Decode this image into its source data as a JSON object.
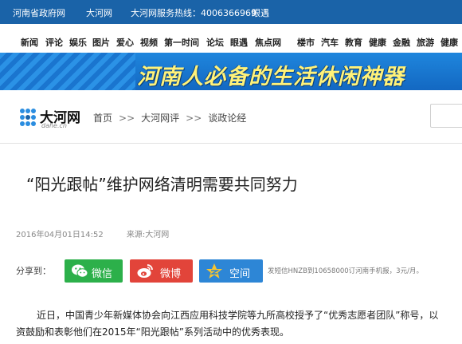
{
  "topbar": {
    "links": [
      "河南省政府网",
      "大河网",
      "大河网服务热线：4006366969",
      "眼遇"
    ]
  },
  "nav": {
    "items": [
      "新闻",
      "评论",
      "娱乐",
      "图片",
      "爱心",
      "视频",
      "第一时间",
      "论坛",
      "眼遇",
      "焦点网",
      "楼市",
      "汽车",
      "教育",
      "健康",
      "金融",
      "旅游",
      "健康"
    ]
  },
  "banner": {
    "text": "河南人必备的生活休闲神器"
  },
  "site": {
    "logo_name": "大河网",
    "logo_sub": "dahe.cn"
  },
  "breadcrumb": {
    "items": [
      "首页",
      "大河网评",
      "谈政论经"
    ],
    "separator": ">>"
  },
  "article": {
    "title": "“阳光跟帖”维护网络清明需要共同努力",
    "date": "2016年04月01日14:52",
    "source": "来源:大河网",
    "paragraph": "近日，中国青少年新媒体协会向江西应用科技学院等九所高校授予了“优秀志愿者团队”称号，以资鼓励和表彰他们在2015年“阳光跟帖”系列活动中的优秀表现。"
  },
  "share": {
    "label": "分享到：",
    "buttons": [
      {
        "label": "微信",
        "icon": "wechat-icon",
        "color": "#2cb04a"
      },
      {
        "label": "微博",
        "icon": "weibo-icon",
        "color": "#e2443a"
      },
      {
        "label": "空间",
        "icon": "qzone-icon",
        "color": "#2d86d6"
      }
    ],
    "promo": "发短信HNZB到10658000订河南手机报，3元/月。"
  },
  "colors": {
    "topbar": "#1a63a8",
    "banner_text": "#fff27a"
  }
}
